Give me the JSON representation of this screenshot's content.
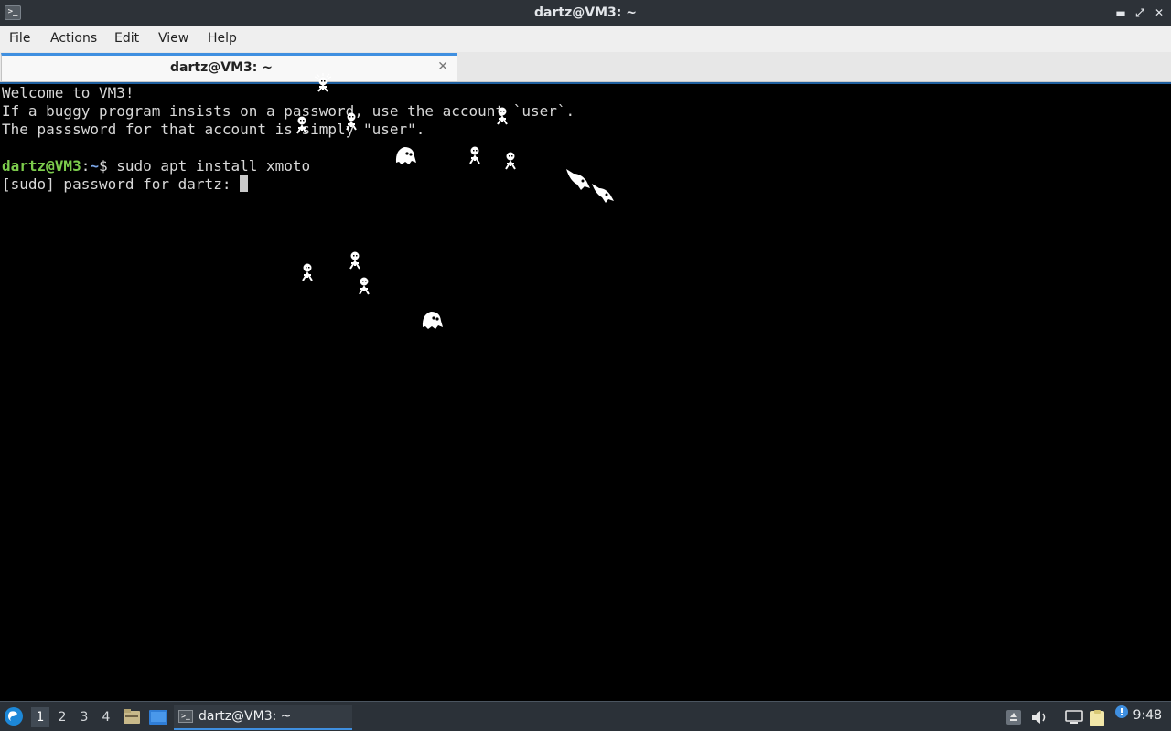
{
  "window": {
    "title": "dartz@VM3: ~",
    "controls": {
      "minimize": "▬",
      "restore": "⤢",
      "close": "✕"
    }
  },
  "menubar": {
    "items": [
      "File",
      "Actions",
      "Edit",
      "View",
      "Help"
    ]
  },
  "tabs": [
    {
      "label": "dartz@VM3: ~",
      "close": "✕"
    }
  ],
  "terminal": {
    "welcome": "Welcome to VM3!",
    "notice_line1": "If a buggy program insists on a password, use the account `user`.",
    "notice_line2": "The passsword for that account is simply \"user\".",
    "prompt_user": "dartz@VM3",
    "prompt_sep": ":",
    "prompt_path": "~",
    "prompt_suffix": "$ ",
    "command": "sudo apt install xmoto",
    "sudo_prompt": "[sudo] password for dartz: "
  },
  "taskbar": {
    "workspaces": [
      "1",
      "2",
      "3",
      "4"
    ],
    "active_workspace": "1",
    "task_label": "dartz@VM3: ~",
    "clock": "9:48",
    "tray_icons": [
      "upload-icon",
      "volume-icon",
      "network-icon",
      "clipboard-icon",
      "notification-icon"
    ]
  },
  "colors": {
    "titlebar_bg": "#2d3238",
    "accent": "#3f8fe0",
    "prompt_user": "#7ccc4c",
    "prompt_path": "#7aa5e6",
    "terminal_bg": "#000000",
    "terminal_fg": "#d8d8d8"
  }
}
